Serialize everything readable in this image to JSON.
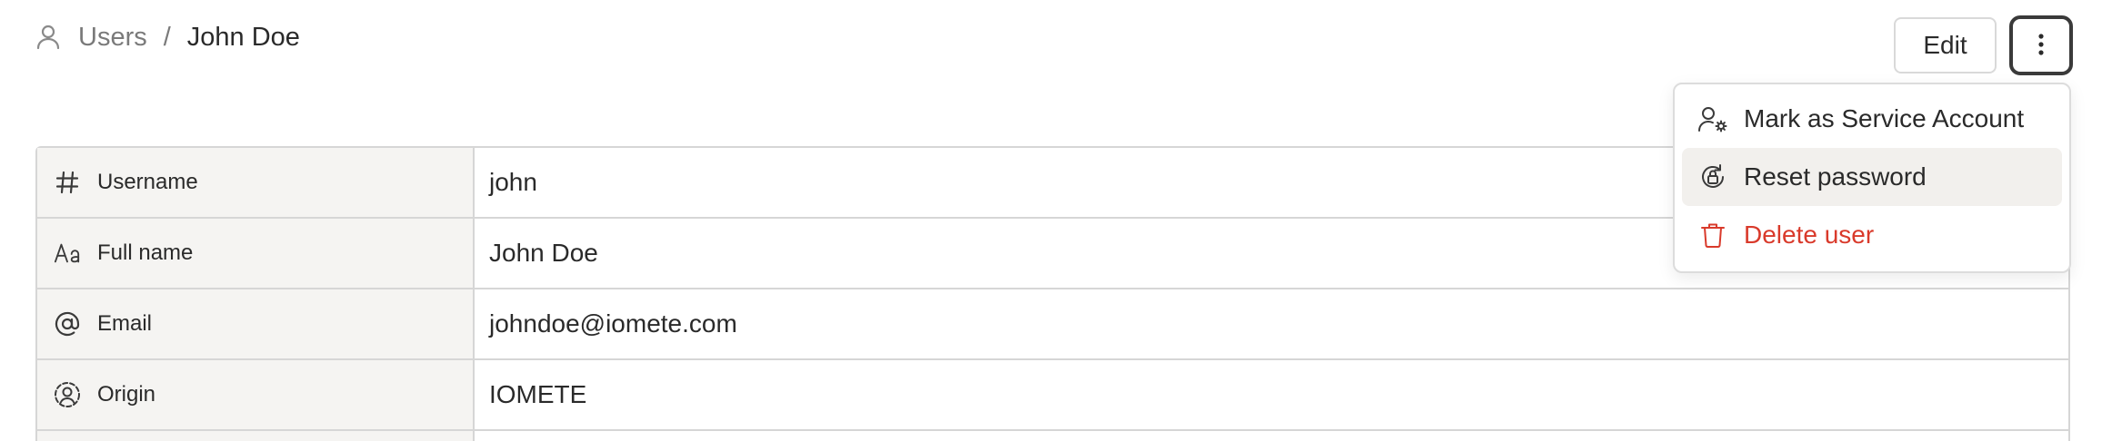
{
  "breadcrumb": {
    "icon": "user-icon",
    "parent": "Users",
    "separator": "/",
    "current": "John Doe"
  },
  "header": {
    "edit_label": "Edit",
    "more_icon": "more-vertical-icon"
  },
  "menu": {
    "items": [
      {
        "label": "Mark as Service Account",
        "icon": "user-cog-icon"
      },
      {
        "label": "Reset password",
        "icon": "lock-reset-icon"
      },
      {
        "label": "Delete user",
        "icon": "trash-icon",
        "color": "#d93a2b"
      }
    ]
  },
  "table": {
    "rows": [
      {
        "label": "Username",
        "icon": "hash-icon",
        "value": "john"
      },
      {
        "label": "Full name",
        "icon": "text-case-icon",
        "value": "John Doe"
      },
      {
        "label": "Email",
        "icon": "at-sign-icon",
        "value": "johndoe@iomete.com"
      },
      {
        "label": "Origin",
        "icon": "user-circle-dashed-icon",
        "value": "IOMETE"
      }
    ]
  },
  "colors": {
    "label_bg": "#f5f4f2",
    "border": "#d6d6d6",
    "danger": "#d93a2b",
    "hover_bg": "#f2f0ed"
  }
}
